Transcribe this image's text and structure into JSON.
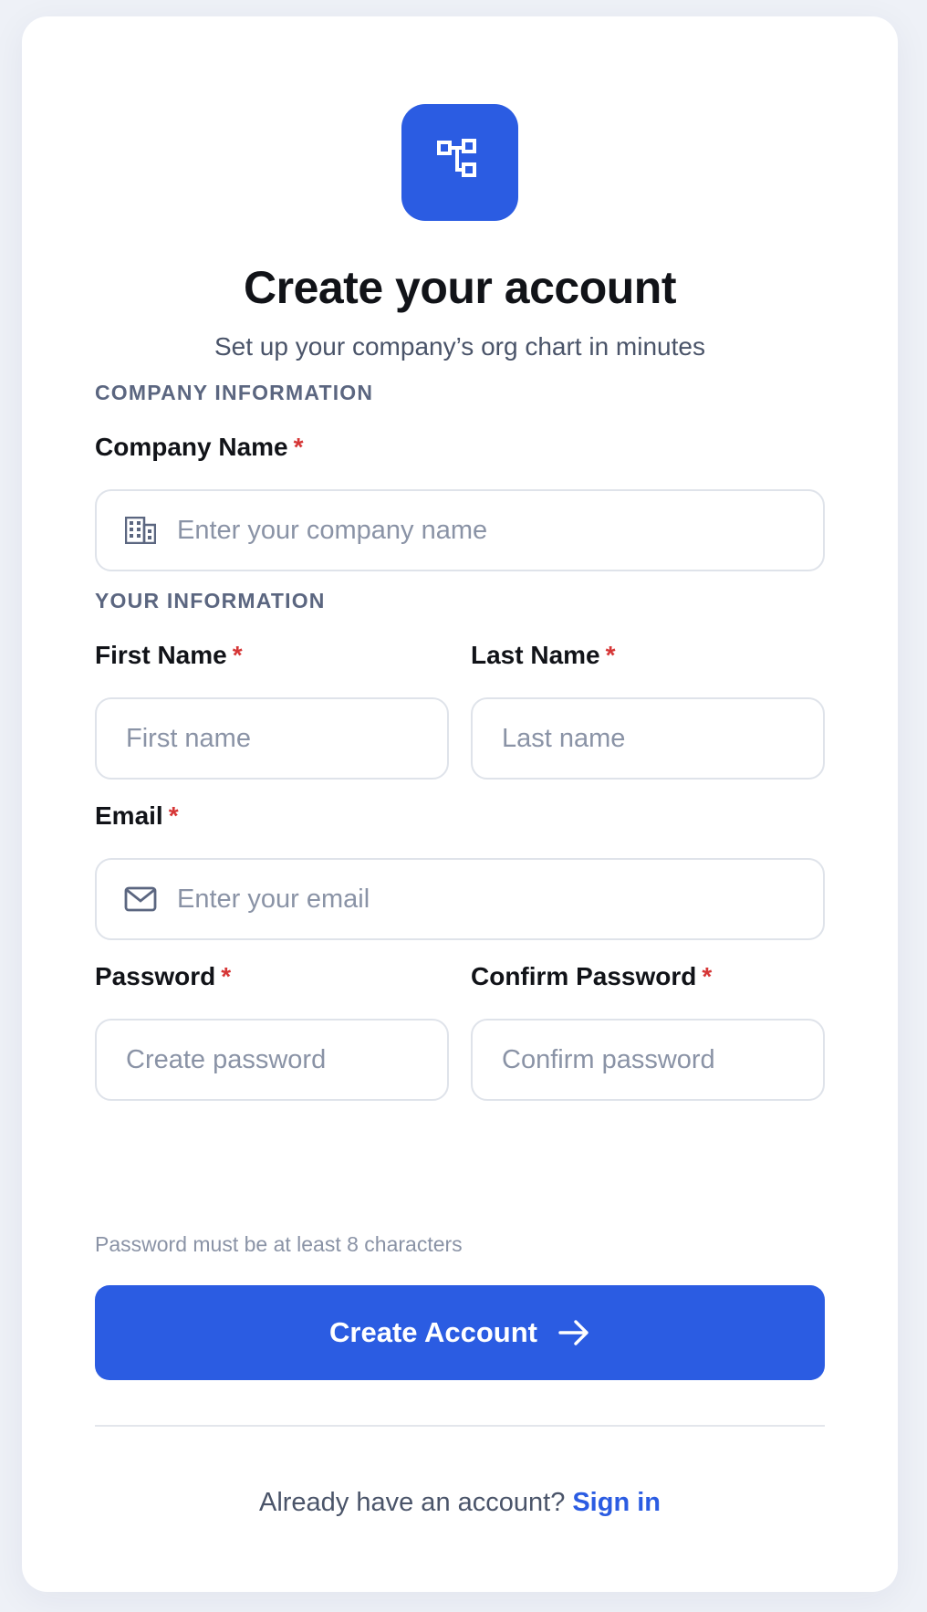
{
  "header": {
    "logo_icon": "org-chart-icon",
    "title": "Create your account",
    "subtitle": "Set up your company’s org chart in minutes"
  },
  "company_section": {
    "heading": "COMPANY INFORMATION",
    "company_name": {
      "label": "Company Name",
      "required_mark": "*",
      "icon": "building-icon",
      "placeholder": "Enter your company name",
      "value": ""
    }
  },
  "user_section": {
    "heading": "YOUR INFORMATION",
    "first_name": {
      "label": "First Name",
      "required_mark": "*",
      "placeholder": "First name",
      "value": ""
    },
    "last_name": {
      "label": "Last Name",
      "required_mark": "*",
      "placeholder": "Last name",
      "value": ""
    },
    "email": {
      "label": "Email",
      "required_mark": "*",
      "icon": "mail-icon",
      "placeholder": "Enter your email",
      "value": ""
    },
    "password": {
      "label": "Password",
      "required_mark": "*",
      "placeholder": "Create password",
      "value": ""
    },
    "confirm_password": {
      "label": "Confirm Password",
      "required_mark": "*",
      "placeholder": "Confirm password",
      "value": ""
    },
    "password_hint": "Password must be at least 8 characters"
  },
  "actions": {
    "submit_label": "Create Account",
    "submit_icon": "arrow-right-icon"
  },
  "footer": {
    "prompt": "Already have an account?",
    "link_label": "Sign in"
  },
  "colors": {
    "accent": "#2b5ce2",
    "required": "#d63636",
    "background": "#eef1f7"
  }
}
